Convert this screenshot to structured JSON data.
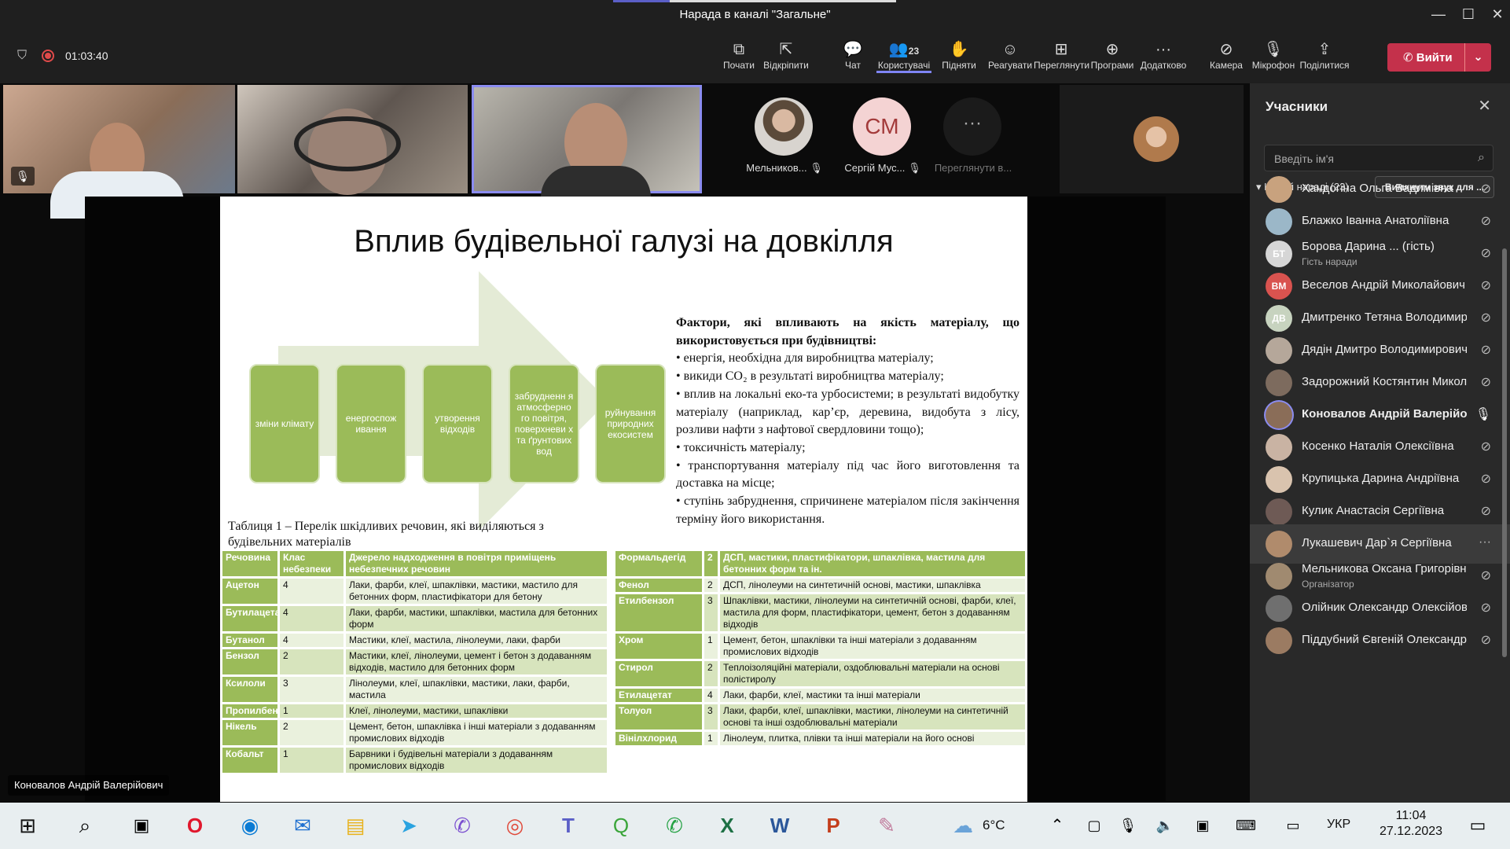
{
  "window": {
    "title": "Нарада в каналі \"Загальне\"",
    "minimize": "—",
    "maximize": "☐",
    "close": "✕"
  },
  "toolbar": {
    "timer": "01:03:40",
    "items": [
      {
        "label": "Почати",
        "icon": "share-screen-icon"
      },
      {
        "label": "Відкріпити",
        "icon": "pop-out-icon"
      },
      {
        "label": "Чат",
        "icon": "chat-icon"
      },
      {
        "label": "Користувачі",
        "icon": "people-icon",
        "count": "23"
      },
      {
        "label": "Підняти",
        "icon": "hand-icon"
      },
      {
        "label": "Реагувати",
        "icon": "smile-icon"
      },
      {
        "label": "Переглянути",
        "icon": "view-icon"
      },
      {
        "label": "Програми",
        "icon": "apps-icon"
      },
      {
        "label": "Додатково",
        "icon": "more-icon"
      },
      {
        "label": "Камера",
        "icon": "camera-off-icon"
      },
      {
        "label": "Мікрофон",
        "icon": "mic-off-icon"
      },
      {
        "label": "Поділитися",
        "icon": "share-icon"
      }
    ],
    "leave": "Вийти"
  },
  "stage": {
    "avatars": [
      {
        "label": "Мельников..."
      },
      {
        "label": "Сергій Мус...",
        "initials": "СМ"
      },
      {
        "label": "Переглянути в..."
      }
    ],
    "speaker_name": "Коновалов Андрій Валерійович"
  },
  "slide": {
    "title": "Вплив будівельної галузі на довкілля",
    "boxes": [
      "зміни клімату",
      "енергоспож ивання",
      "утворення відходів",
      "забрудненн я атмосферно го повітря, поверхневи х та ґрунтових вод",
      "руйнування природних екосистем"
    ],
    "factors_heading": "Фактори, які впливають на якість матеріалу, що використовується при будівництві:",
    "factors": [
      "• енергія, необхідна для виробництва матеріалу;",
      "• викиди CO₂ в результаті виробництва матеріалу;",
      "• вплив на локальні еко-та урбосистеми; в результаті видобутку матеріалу (наприклад, кар’єр, деревина, видобута з лісу, розливи нафти з нафтової свердловини тощо);",
      "• токсичність матеріалу;",
      "• транспортування матеріалу під час його виготовлення та доставка на місце;",
      "• ступінь забруднення, спричинене матеріалом після закінчення терміну його використання."
    ],
    "table_caption": "Таблиця 1 – Перелік шкідливих речовин, які виділяються з будівельних матеріалів",
    "table_headers": [
      "Речовина",
      "Клас небезпеки",
      "Джерело надходження в повітря приміщень небезпечних речовин"
    ],
    "table_left": [
      [
        "Ацетон",
        "4",
        "Лаки, фарби, клеї, шпаклівки, мастики, мастило для бетонних форм, пластифікатори для бетону"
      ],
      [
        "Бутилацетат",
        "4",
        "Лаки, фарби, мастики, шпаклівки, мастила для бетонних форм"
      ],
      [
        "Бутанол",
        "4",
        "Мастики, клеї, мастила, лінолеуми, лаки, фарби"
      ],
      [
        "Бензол",
        "2",
        "Мастики, клеї, лінолеуми, цемент і бетон з додаванням відходів, мастило для бетонних форм"
      ],
      [
        "Ксилоли",
        "3",
        "Лінолеуми, клеї, шпаклівки, мастики, лаки, фарби, мастила"
      ],
      [
        "Пропилбензол",
        "1",
        "Клеї, лінолеуми, мастики, шпаклівки"
      ],
      [
        "Нікель",
        "2",
        "Цемент, бетон, шпаклівка і інші матеріали з додаванням промислових відходів"
      ],
      [
        "Кобальт",
        "1",
        "Барвники і будівельні матеріали з додаванням промислових відходів"
      ]
    ],
    "table_right_header": [
      "Формальдегід",
      "2",
      "ДСП, мастики, пластифікатори, шпаклівка, мастила для бетонних форм та ін."
    ],
    "table_right": [
      [
        "Фенол",
        "2",
        "ДСП, лінолеуми на синтетичній основі, мастики, шпаклівка"
      ],
      [
        "Етилбензол",
        "3",
        "Шпаклівки, мастики, лінолеуми на синтетичній основі, фарби, клеї, мастила для форм, пластифікатори, цемент, бетон з додаванням відходів"
      ],
      [
        "Хром",
        "1",
        "Цемент, бетон, шпаклівки та інші матеріали з додаванням промислових відходів"
      ],
      [
        "Стирол",
        "2",
        "Теплоізоляційні матеріали, оздоблювальні матеріали на основі полістиролу"
      ],
      [
        "Етилацетат",
        "4",
        "Лаки, фарби, клеї, мастики та інші матеріали"
      ],
      [
        "Толуол",
        "3",
        "Лаки, фарби, клеї, шпаклівки, мастики, лінолеуми на синтетичній основі та інші оздоблювальні матеріали"
      ],
      [
        "Вінілхлорид",
        "1",
        "Лінолеум, плитка, плівки та інші матеріали на його основі"
      ]
    ]
  },
  "panel": {
    "title": "Учасники",
    "search_placeholder": "Введіть ім'я",
    "in_call": "На цій нараді (23)",
    "mute_all": "Вимкнути звук для ...",
    "participants": [
      {
        "name": "Хандогіна Ольга Вадимівна",
        "avatar": "#c8a27e"
      },
      {
        "name": "Блажко Іванна Анатоліївна",
        "avatar": "#9bb7c8"
      },
      {
        "name": "Борова Дарина ... (гість)",
        "sub": "Гість наради",
        "initials": "БТ",
        "avatar": "#d6d6d6"
      },
      {
        "name": "Веселов Андрій Миколайович",
        "initials": "ВМ",
        "avatar": "#d9534f"
      },
      {
        "name": "Дмитренко Тетяна Володимирі...",
        "initials": "ДВ",
        "avatar": "#c7d3bf"
      },
      {
        "name": "Дядін Дмитро Володимирович",
        "avatar": "#b5a79a"
      },
      {
        "name": "Задорожний Костянтин Микол...",
        "avatar": "#7d6b5e"
      },
      {
        "name": "Коновалов Андрій Валерійович",
        "avatar": "#8a6d58",
        "active": "1"
      },
      {
        "name": "Косенко Наталія Олексіївна",
        "avatar": "#c9b3a3"
      },
      {
        "name": "Крупицька Дарина Андріївна",
        "avatar": "#d9c3ae"
      },
      {
        "name": "Кулик Анастасія Сергіївна",
        "avatar": "#6e5a55"
      },
      {
        "name": "Лукашевич Дар`я Сергіївна",
        "avatar": "#b08b6c",
        "hover": "1"
      },
      {
        "name": "Мельникова Оксана Григорівна",
        "sub": "Організатор",
        "avatar": "#a08a70"
      },
      {
        "name": "Олійник Олександр Олексійович",
        "avatar": "#6f6f6f"
      },
      {
        "name": "Піддубний Євгеній Олександро...",
        "avatar": "#9b7b62"
      }
    ]
  },
  "taskbar": {
    "weather": "6°C",
    "lang": "УКР",
    "time": "11:04",
    "date": "27.12.2023"
  }
}
